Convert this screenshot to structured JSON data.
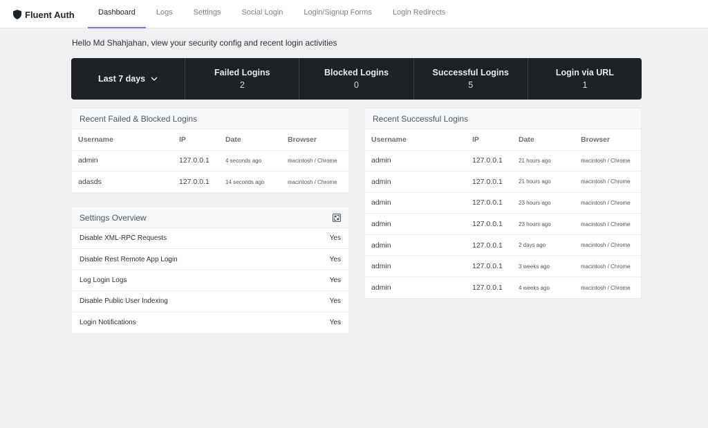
{
  "brand": {
    "name": "Fluent Auth"
  },
  "nav": [
    "Dashboard",
    "Logs",
    "Settings",
    "Social Login",
    "Login/Signup Forms",
    "Login Redirects"
  ],
  "greeting": "Hello Md Shahjahan, view your security config and recent login activities",
  "range": {
    "label": "Last 7 days"
  },
  "stats": [
    {
      "label": "Failed Logins",
      "value": "2"
    },
    {
      "label": "Blocked Logins",
      "value": "0"
    },
    {
      "label": "Successful Logins",
      "value": "5"
    },
    {
      "label": "Login via URL",
      "value": "1"
    }
  ],
  "failed": {
    "title": "Recent Failed & Blocked Logins",
    "columns": [
      "Username",
      "IP",
      "Date",
      "Browser"
    ],
    "rows": [
      [
        "admin",
        "127.0.0.1",
        "4 seconds ago",
        "macintosh / Chrome"
      ],
      [
        "adasds",
        "127.0.0.1",
        "14 seconds ago",
        "macintosh / Chrome"
      ]
    ]
  },
  "successful": {
    "title": "Recent Successful Logins",
    "columns": [
      "Username",
      "IP",
      "Date",
      "Browser"
    ],
    "rows": [
      [
        "admin",
        "127.0.0.1",
        "21 hours ago",
        "macintosh / Chrome"
      ],
      [
        "admin",
        "127.0.0.1",
        "21 hours ago",
        "macintosh / Chrome"
      ],
      [
        "admin",
        "127.0.0.1",
        "23 hours ago",
        "macintosh / Chrome"
      ],
      [
        "admin",
        "127.0.0.1",
        "23 hours ago",
        "macintosh / Chrome"
      ],
      [
        "admin",
        "127.0.0.1",
        "2 days ago",
        "macintosh / Chrome"
      ],
      [
        "admin",
        "127.0.0.1",
        "3 weeks ago",
        "macintosh / Chrome"
      ],
      [
        "admin",
        "127.0.0.1",
        "4 weeks ago",
        "macintosh / Chrome"
      ]
    ]
  },
  "settings": {
    "title": "Settings Overview",
    "icon": "settings-link-icon",
    "items": [
      {
        "label": "Disable XML-RPC Requests",
        "value": "Yes"
      },
      {
        "label": "Disable Rest Remote App Login",
        "value": "Yes"
      },
      {
        "label": "Log Login Logs",
        "value": "Yes"
      },
      {
        "label": "Disable Public User Indexing",
        "value": "Yes"
      },
      {
        "label": "Login Notifications",
        "value": "Yes"
      }
    ]
  }
}
